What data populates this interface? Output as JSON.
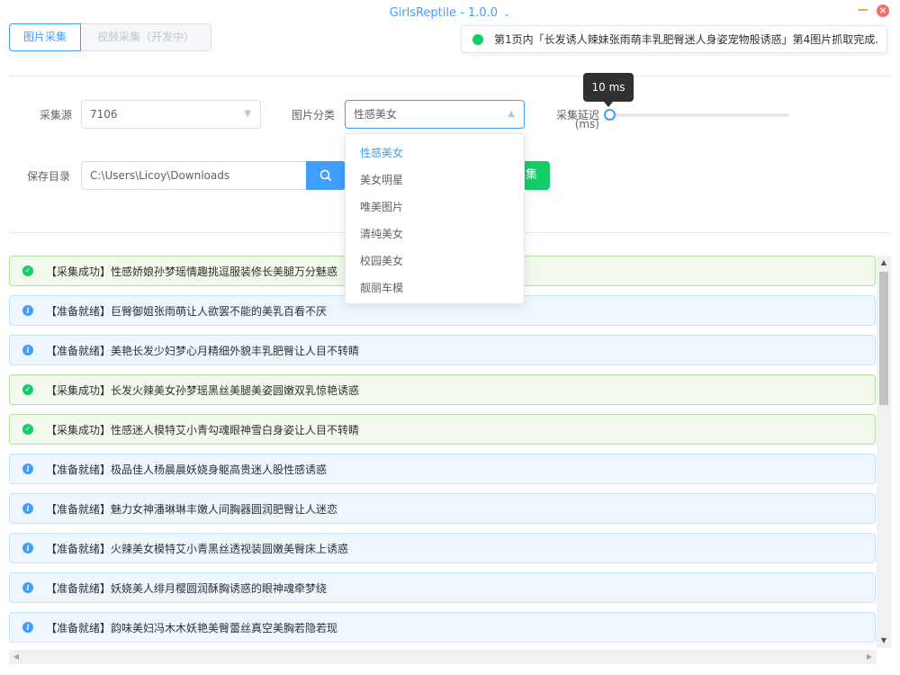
{
  "window": {
    "title": "GirlsReptile - 1.0.0",
    "minimize_glyph": "−",
    "close_glyph": "×"
  },
  "tabs": [
    {
      "label": "图片采集",
      "active": true
    },
    {
      "label": "视频采集（开发中）",
      "disabled": true
    }
  ],
  "notification": {
    "text": "第1页内「长发诱人辣妹张雨萌丰乳肥臀迷人身姿宠物般诱惑」第4图片抓取完成.",
    "color": "#13ce66"
  },
  "form": {
    "source_label": "采集源",
    "source_value": "7106",
    "category_label": "图片分类",
    "category_value": "性感美女",
    "delay_label": "采集延迟",
    "delay_unit": "(ms)",
    "delay_tooltip": "10 ms",
    "delay_value": 10,
    "save_label": "保存目录",
    "save_path": "C:\\Users\\Licoy\\Downloads",
    "start_label": "集"
  },
  "category_options": [
    "性感美女",
    "美女明星",
    "唯美图片",
    "清纯美女",
    "校园美女",
    "靓丽车模"
  ],
  "logs": [
    {
      "type": "success",
      "text": "【采集成功】性感娇娘孙梦瑶情趣挑逗服装修长美腿万分魅惑"
    },
    {
      "type": "info",
      "text": "【准备就绪】巨臀御姐张雨萌让人欲罢不能的美乳百看不厌"
    },
    {
      "type": "info",
      "text": "【准备就绪】美艳长发少妇梦心月精细外貌丰乳肥臀让人目不转睛"
    },
    {
      "type": "success",
      "text": "【采集成功】长发火辣美女孙梦瑶黑丝美腿美姿圆嫩双乳惊艳诱惑"
    },
    {
      "type": "success",
      "text": "【采集成功】性感迷人模特艾小青勾魂眼神雪白身姿让人目不转睛"
    },
    {
      "type": "info",
      "text": "【准备就绪】极品佳人杨晨晨妖娆身躯高贵迷人股性感诱惑"
    },
    {
      "type": "info",
      "text": "【准备就绪】魅力女神潘琳琳丰嫩人间胸器圆润肥臀让人迷恋"
    },
    {
      "type": "info",
      "text": "【准备就绪】火辣美女模特艾小青黑丝透视装圆嫩美臀床上诱惑"
    },
    {
      "type": "info",
      "text": "【准备就绪】妖娆美人绯月樱圆润酥胸诱惑的眼神魂牵梦绕"
    },
    {
      "type": "info",
      "text": "【准备就绪】韵味美妇冯木木妖艳美臀蕾丝真空美胸若隐若现"
    }
  ],
  "colors": {
    "primary": "#409eff",
    "success": "#13ce66",
    "danger": "#f56c6c"
  }
}
